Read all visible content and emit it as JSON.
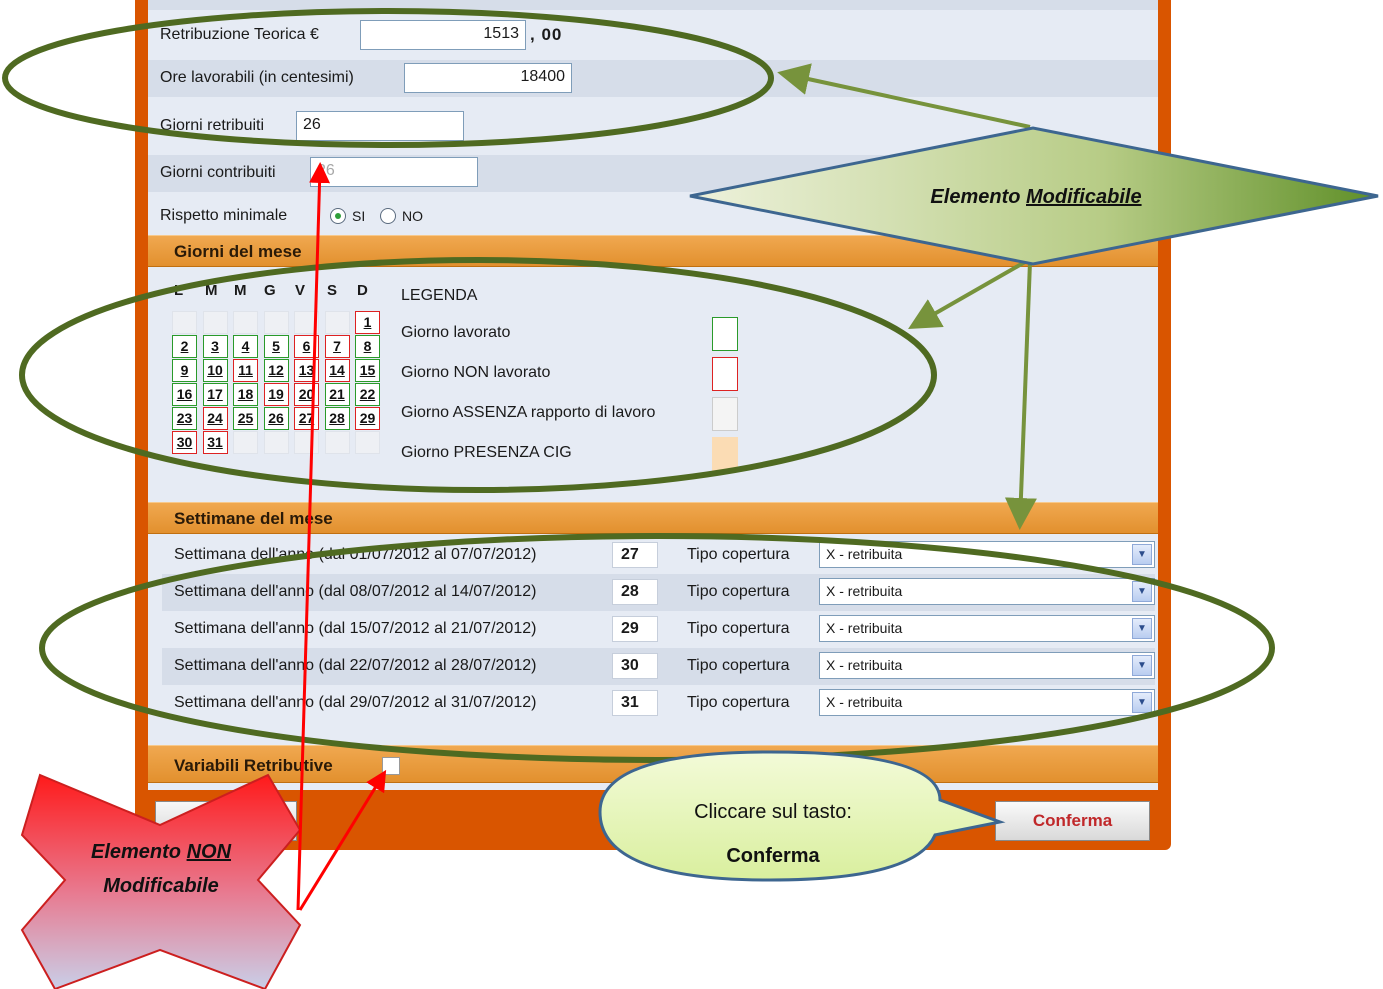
{
  "form": {
    "retribuzione_label": "Retribuzione Teorica €",
    "retribuzione_value": "1513",
    "retribuzione_cents": ", 00",
    "ore_label": "Ore lavorabili (in centesimi)",
    "ore_value": "18400",
    "giorni_retribuiti_label": "Giorni retribuiti",
    "giorni_retribuiti_value": "26",
    "giorni_contribuiti_label": "Giorni contribuiti",
    "giorni_contribuiti_value": "26",
    "rispetto_label": "Rispetto minimale",
    "si_label": "SI",
    "no_label": "NO",
    "rispetto_selected": "SI"
  },
  "calendar": {
    "title": "Giorni del mese",
    "weekdays": [
      "L",
      "M",
      "M",
      "G",
      "V",
      "S",
      "D"
    ],
    "legend_title": "LEGENDA",
    "legend": [
      {
        "label": "Giorno lavorato",
        "border": "#2a9a2a",
        "fill": "#ffffff"
      },
      {
        "label": "Giorno NON lavorato",
        "border": "#dd2222",
        "fill": "#ffffff"
      },
      {
        "label": "Giorno ASSENZA rapporto di lavoro",
        "border": "#cccccc",
        "fill": "#f4f4f4"
      },
      {
        "label": "Giorno PRESENZA CIG",
        "border": "#fbdcb4",
        "fill": "#fbdcb4"
      }
    ],
    "weeks": [
      [
        null,
        null,
        null,
        null,
        null,
        null,
        {
          "d": "1",
          "s": "off"
        }
      ],
      [
        {
          "d": "2",
          "s": "on"
        },
        {
          "d": "3",
          "s": "on"
        },
        {
          "d": "4",
          "s": "on"
        },
        {
          "d": "5",
          "s": "on"
        },
        {
          "d": "6",
          "s": "off"
        },
        {
          "d": "7",
          "s": "off"
        },
        {
          "d": "8",
          "s": "on"
        }
      ],
      [
        {
          "d": "9",
          "s": "on"
        },
        {
          "d": "10",
          "s": "on"
        },
        {
          "d": "11",
          "s": "off"
        },
        {
          "d": "12",
          "s": "on"
        },
        {
          "d": "13",
          "s": "off"
        },
        {
          "d": "14",
          "s": "off"
        },
        {
          "d": "15",
          "s": "on"
        }
      ],
      [
        {
          "d": "16",
          "s": "on"
        },
        {
          "d": "17",
          "s": "on"
        },
        {
          "d": "18",
          "s": "on"
        },
        {
          "d": "19",
          "s": "off"
        },
        {
          "d": "20",
          "s": "off"
        },
        {
          "d": "21",
          "s": "on"
        },
        {
          "d": "22",
          "s": "on"
        }
      ],
      [
        {
          "d": "23",
          "s": "on"
        },
        {
          "d": "24",
          "s": "off"
        },
        {
          "d": "25",
          "s": "on"
        },
        {
          "d": "26",
          "s": "on"
        },
        {
          "d": "27",
          "s": "off"
        },
        {
          "d": "28",
          "s": "on"
        },
        {
          "d": "29",
          "s": "off"
        }
      ],
      [
        {
          "d": "30",
          "s": "off"
        },
        {
          "d": "31",
          "s": "off"
        },
        null,
        null,
        null,
        null,
        null
      ]
    ]
  },
  "weeks_section": {
    "title": "Settimane del mese",
    "tipo_label": "Tipo copertura",
    "rows": [
      {
        "label": "Settimana dell'anno (dal 01/07/2012 al 07/07/2012)",
        "num": "27",
        "tipo": "X - retribuita"
      },
      {
        "label": "Settimana dell'anno (dal 08/07/2012 al 14/07/2012)",
        "num": "28",
        "tipo": "X - retribuita"
      },
      {
        "label": "Settimana dell'anno (dal 15/07/2012 al 21/07/2012)",
        "num": "29",
        "tipo": "X - retribuita"
      },
      {
        "label": "Settimana dell'anno (dal 22/07/2012 al 28/07/2012)",
        "num": "30",
        "tipo": "X - retribuita"
      },
      {
        "label": "Settimana dell'anno (dal 29/07/2012 al 31/07/2012)",
        "num": "31",
        "tipo": "X - retribuita"
      }
    ]
  },
  "variabili": {
    "title": "Variabili Retributive"
  },
  "buttons": {
    "confirm": "Conferma"
  },
  "annotations": {
    "modificabile_prefix": "Elemento ",
    "modificabile_word": "Modificabile",
    "non_line1_prefix": "Elemento ",
    "non_line1_word": "NON",
    "non_line2": "Modificabile",
    "callout_line1": "Cliccare sul tasto:",
    "callout_line2": "Conferma"
  },
  "colors": {
    "panel_orange": "#d95500",
    "section_orange": "#e2902e",
    "annotation_green": "#4f6a21",
    "arrow_green": "#77933c",
    "arrow_red": "#ff0000"
  }
}
